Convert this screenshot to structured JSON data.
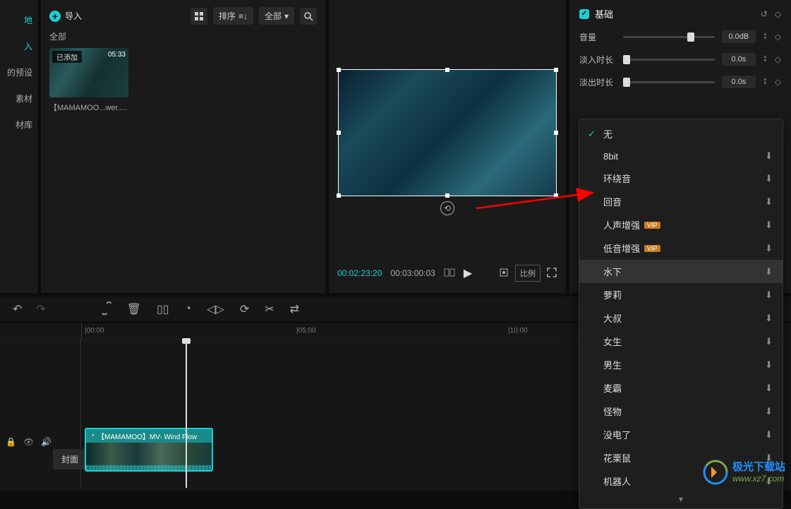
{
  "sidebar": {
    "items": [
      {
        "label": "地"
      },
      {
        "label": "入"
      },
      {
        "label": "的预设"
      },
      {
        "label": "素材"
      },
      {
        "label": "材库"
      }
    ]
  },
  "media": {
    "import_label": "导入",
    "sort_label": "排序",
    "filter_label": "全部",
    "all_tab": "全部",
    "thumb": {
      "badge": "已添加",
      "duration": "05:33",
      "name": "【MAMAMOO...wer.mp4"
    }
  },
  "preview": {
    "current_time": "00:02:23:20",
    "total_time": "00:03:00:03",
    "ratio_label": "比例"
  },
  "props": {
    "title": "基础",
    "volume_label": "音量",
    "volume_value": "0.0dB",
    "fade_in_label": "淡入时长",
    "fade_in_value": "0.0s",
    "fade_out_label": "淡出时长",
    "fade_out_value": "0.0s"
  },
  "effects": {
    "items": [
      {
        "label": "无",
        "selected": true
      },
      {
        "label": "8bit"
      },
      {
        "label": "环绕音"
      },
      {
        "label": "回音"
      },
      {
        "label": "人声增强",
        "vip": true
      },
      {
        "label": "低音增强",
        "vip": true
      },
      {
        "label": "水下",
        "highlighted": true
      },
      {
        "label": "萝莉"
      },
      {
        "label": "大叔"
      },
      {
        "label": "女生"
      },
      {
        "label": "男生"
      },
      {
        "label": "麦霸"
      },
      {
        "label": "怪物"
      },
      {
        "label": "没电了"
      },
      {
        "label": "花栗鼠"
      },
      {
        "label": "机器人"
      }
    ]
  },
  "timeline": {
    "marks": [
      {
        "label": "|00:00",
        "pos": 120
      },
      {
        "label": "|05:00",
        "pos": 420
      },
      {
        "label": "|10:00",
        "pos": 720
      }
    ],
    "cover_label": "封面",
    "clip_name": "【MAMAMOO】MV- Wind Flow"
  },
  "watermark": {
    "cn": "极光下载站",
    "url": "www.xz7.com"
  }
}
